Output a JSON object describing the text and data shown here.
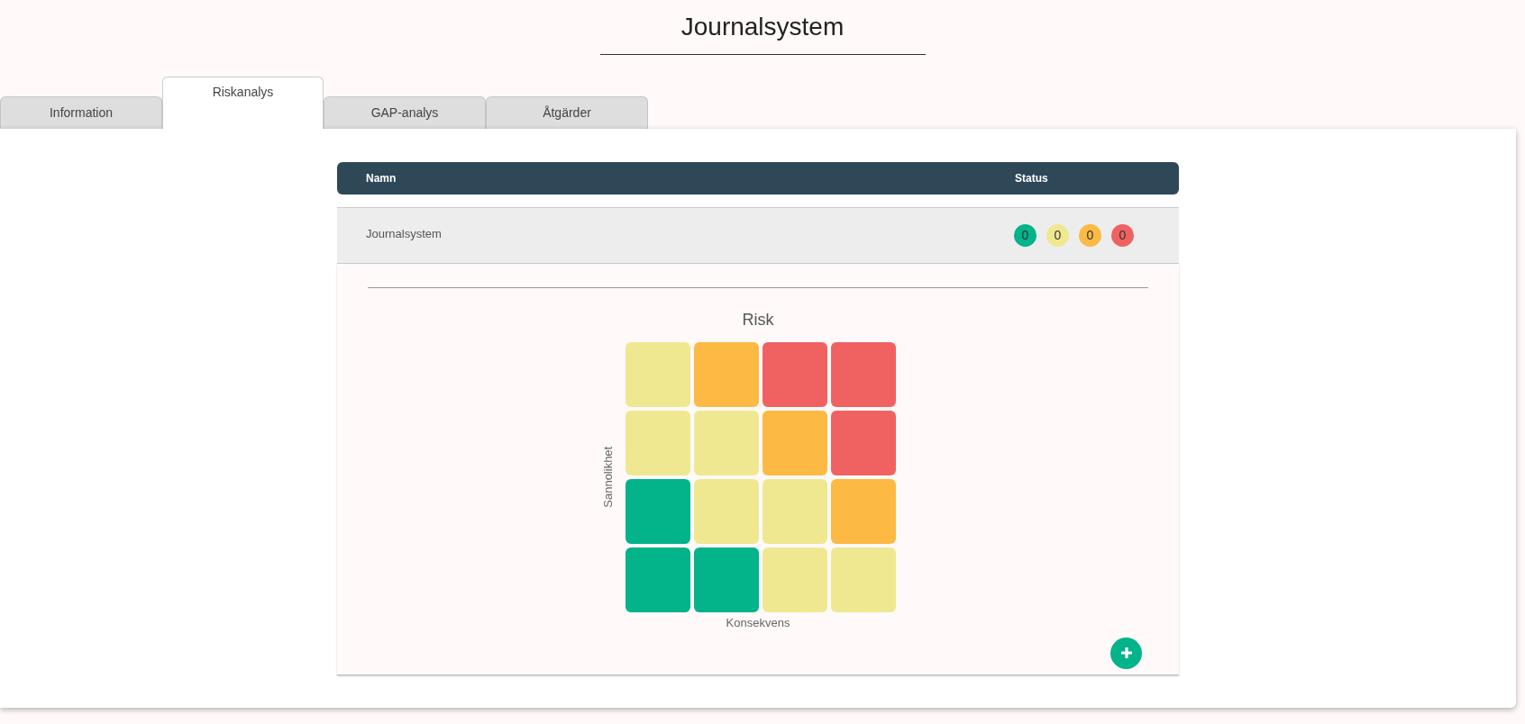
{
  "page_title": "Journalsystem",
  "tabs": [
    {
      "label": "Information",
      "selected": false
    },
    {
      "label": "Riskanalys",
      "selected": true
    },
    {
      "label": "GAP-analys",
      "selected": false
    },
    {
      "label": "Åtgärder",
      "selected": false
    }
  ],
  "table": {
    "columns": [
      "Namn",
      "Status"
    ],
    "rows": [
      {
        "name": "Journalsystem",
        "expanded": true,
        "status": [
          {
            "count": "0",
            "color": "#03b38a"
          },
          {
            "count": "0",
            "color": "#f0e891"
          },
          {
            "count": "0",
            "color": "#fcb944"
          },
          {
            "count": "0",
            "color": "#f06262"
          }
        ]
      }
    ]
  },
  "risk_matrix": {
    "title": "Risk",
    "ylabel": "Sannolikhet",
    "xlabel": "Konsekvens",
    "rows": [
      [
        {
          "color": "#f0e891"
        },
        {
          "color": "#fcb944"
        },
        {
          "color": "#f06262"
        },
        {
          "color": "#f06262"
        }
      ],
      [
        {
          "color": "#f0e891"
        },
        {
          "color": "#f0e891"
        },
        {
          "color": "#fcb944"
        },
        {
          "color": "#f06262"
        }
      ],
      [
        {
          "color": "#03b38a"
        },
        {
          "color": "#f0e891"
        },
        {
          "color": "#f0e891"
        },
        {
          "color": "#fcb944"
        }
      ],
      [
        {
          "color": "#03b38a"
        },
        {
          "color": "#03b38a"
        },
        {
          "color": "#f0e891"
        },
        {
          "color": "#f0e891"
        }
      ]
    ]
  }
}
